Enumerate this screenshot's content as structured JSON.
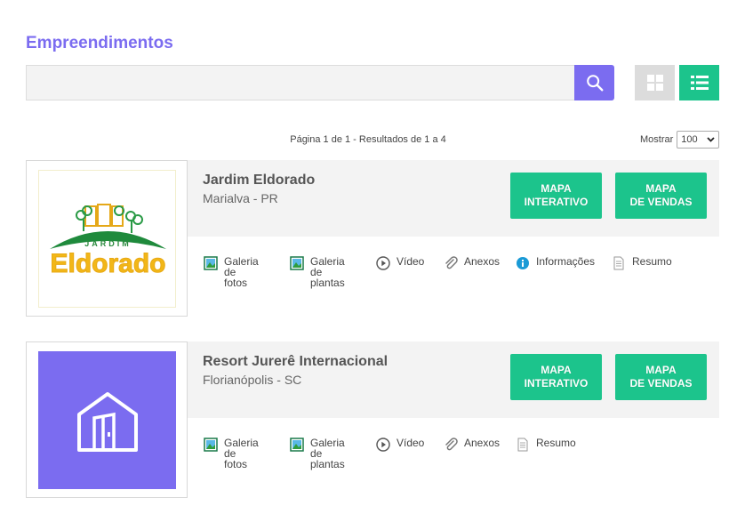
{
  "page": {
    "title": "Empreendimentos"
  },
  "search": {
    "value": "",
    "placeholder": ""
  },
  "pagination": {
    "info": "Página 1 de 1 - Resultados de 1 a 4",
    "show_label": "Mostrar",
    "show_value": "100"
  },
  "colors": {
    "accent": "#7b6cf0",
    "green": "#1cc48c",
    "panel": "#f3f3f3"
  },
  "cards": [
    {
      "title": "Jardim Eldorado",
      "city": "Marialva - PR",
      "logo": {
        "small": "JARDIM",
        "big": "Eldorado"
      },
      "btn_map": [
        "MAPA",
        "INTERATIVO"
      ],
      "btn_sales": [
        "MAPA",
        "DE VENDAS"
      ],
      "links": [
        {
          "icon": "image-gallery-icon",
          "label": [
            "Galeria de",
            "fotos"
          ]
        },
        {
          "icon": "image-gallery-icon",
          "label": [
            "Galeria de",
            "plantas"
          ]
        },
        {
          "icon": "play-icon",
          "label": [
            "Vídeo"
          ]
        },
        {
          "icon": "paperclip-icon",
          "label": [
            "Anexos"
          ]
        },
        {
          "icon": "info-icon",
          "label": [
            "Informações"
          ]
        },
        {
          "icon": "document-icon",
          "label": [
            "Resumo"
          ]
        }
      ]
    },
    {
      "title": "Resort Jurerê Internacional",
      "city": "Florianópolis - SC",
      "btn_map": [
        "MAPA",
        "INTERATIVO"
      ],
      "btn_sales": [
        "MAPA",
        "DE VENDAS"
      ],
      "links": [
        {
          "icon": "image-gallery-icon",
          "label": [
            "Galeria de",
            "fotos"
          ]
        },
        {
          "icon": "image-gallery-icon",
          "label": [
            "Galeria de",
            "plantas"
          ]
        },
        {
          "icon": "play-icon",
          "label": [
            "Vídeo"
          ]
        },
        {
          "icon": "paperclip-icon",
          "label": [
            "Anexos"
          ]
        },
        {
          "icon": "document-icon",
          "label": [
            "Resumo"
          ]
        }
      ]
    }
  ]
}
